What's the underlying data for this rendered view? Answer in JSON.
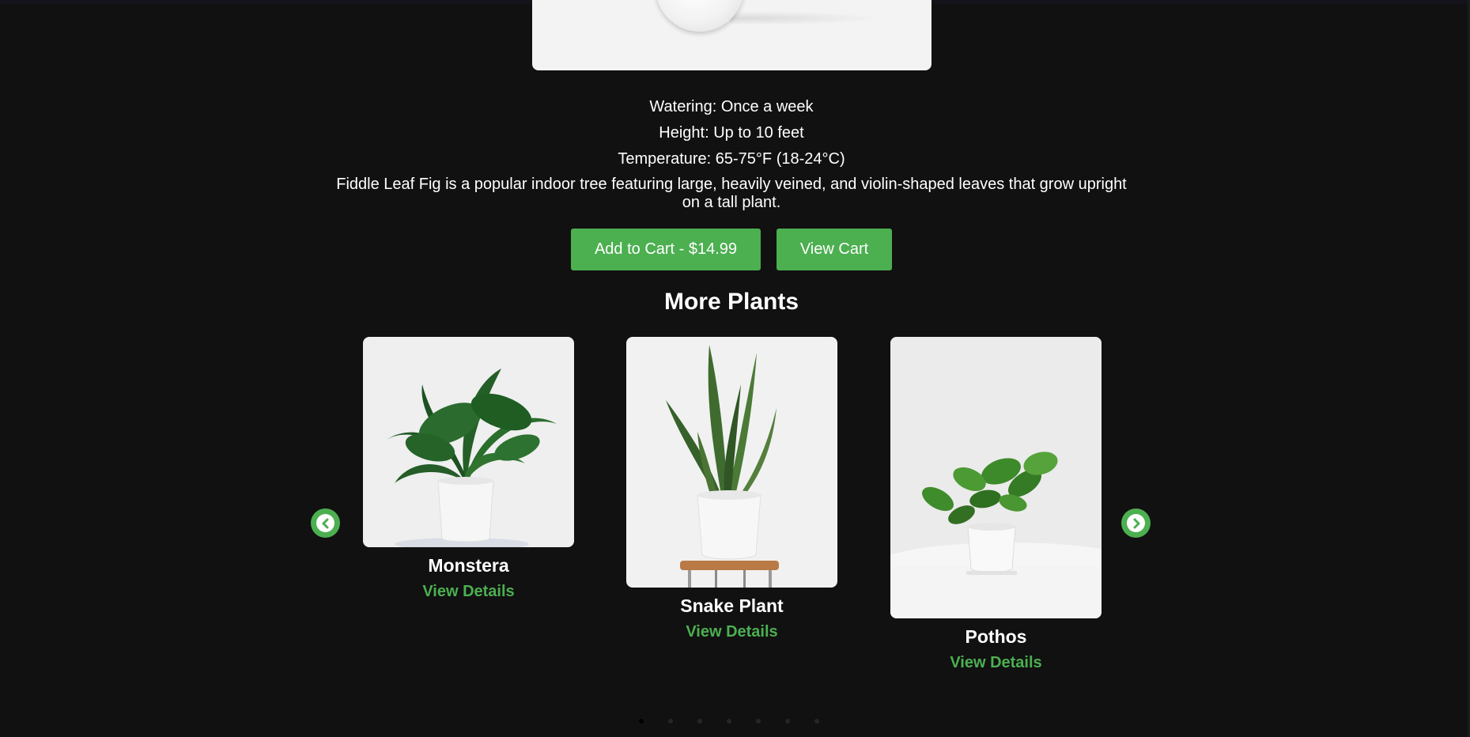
{
  "product": {
    "watering": "Watering: Once a week",
    "height": "Height: Up to 10 feet",
    "temperature": "Temperature: 65-75°F (18-24°C)",
    "description": "Fiddle Leaf Fig is a popular indoor tree featuring large, heavily veined, and violin-shaped leaves that grow upright on a tall plant.",
    "add_to_cart_label": "Add to Cart - $14.99",
    "view_cart_label": "View Cart"
  },
  "more_plants": {
    "title": "More Plants",
    "items": [
      {
        "name": "Monstera",
        "link_label": "View Details"
      },
      {
        "name": "Snake Plant",
        "link_label": "View Details"
      },
      {
        "name": "Pothos",
        "link_label": "View Details"
      }
    ],
    "dots_count": 7,
    "active_dot": 0
  },
  "colors": {
    "background": "#111111",
    "accent": "#4caf50",
    "text": "#ffffff"
  },
  "icons": {
    "prev": "chevron-left-circle-icon",
    "next": "chevron-right-circle-icon"
  }
}
